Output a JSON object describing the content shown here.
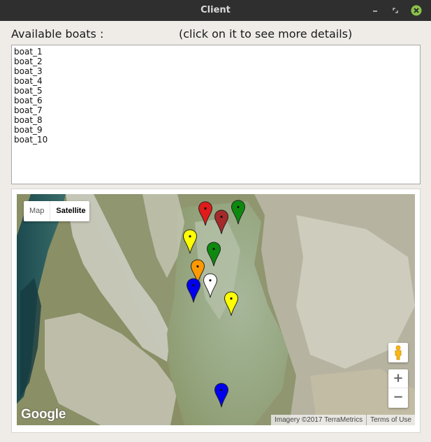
{
  "window": {
    "title": "Client"
  },
  "header": {
    "available_label": "Available boats :",
    "hint": "(click on it to see more details)"
  },
  "boats": [
    "boat_1",
    "boat_2",
    "boat_3",
    "boat_4",
    "boat_5",
    "boat_6",
    "boat_7",
    "boat_8",
    "boat_9",
    "boat_10"
  ],
  "map": {
    "types": [
      "Map",
      "Satellite"
    ],
    "selected_type": "Satellite",
    "logo": "Google",
    "attribution": "Imagery ©2017 TerraMetrics",
    "terms": "Terms of Use",
    "zoom_in": "+",
    "zoom_out": "−",
    "markers": [
      {
        "color": "#e01b1b"
      },
      {
        "color": "#a52a2a"
      },
      {
        "color": "#0d8a0d"
      },
      {
        "color": "#ffff00"
      },
      {
        "color": "#0d8a0d"
      },
      {
        "color": "#ff9900"
      },
      {
        "color": "#0000ee"
      },
      {
        "color": "#ffffff"
      },
      {
        "color": "#ffff00"
      },
      {
        "color": "#0000ee"
      }
    ]
  }
}
